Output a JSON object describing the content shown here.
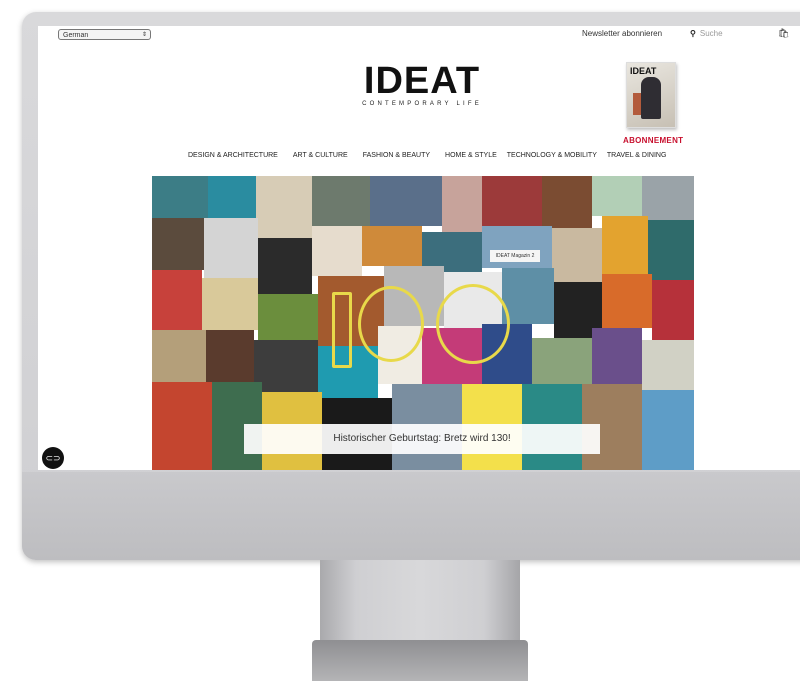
{
  "header": {
    "language": "German",
    "newsletter": "Newsletter abonnieren",
    "search_placeholder": "Suche",
    "search_icon": "search-icon",
    "cart_icon": "shopping-bag-icon"
  },
  "logo": {
    "brand": "IDEAT",
    "tagline": "CONTEMPORARY LIFE"
  },
  "magazine": {
    "title": "IDEAT",
    "cta": "ABONNEMENT",
    "cta_color": "#c8102e"
  },
  "nav": [
    "DESIGN & ARCHITECTURE",
    "ART & CULTURE",
    "FASHION & BEAUTY",
    "HOME & STYLE",
    "TECHNOLOGY & MOBILITY",
    "TRAVEL & DINING"
  ],
  "hero": {
    "caption": "Historischer Geburtstag: Bretz wird 130!",
    "overlay_label": "IDEAT Magazin 2",
    "numeral_color": "#e8d94a"
  },
  "floating_button_icon": "link-icon"
}
